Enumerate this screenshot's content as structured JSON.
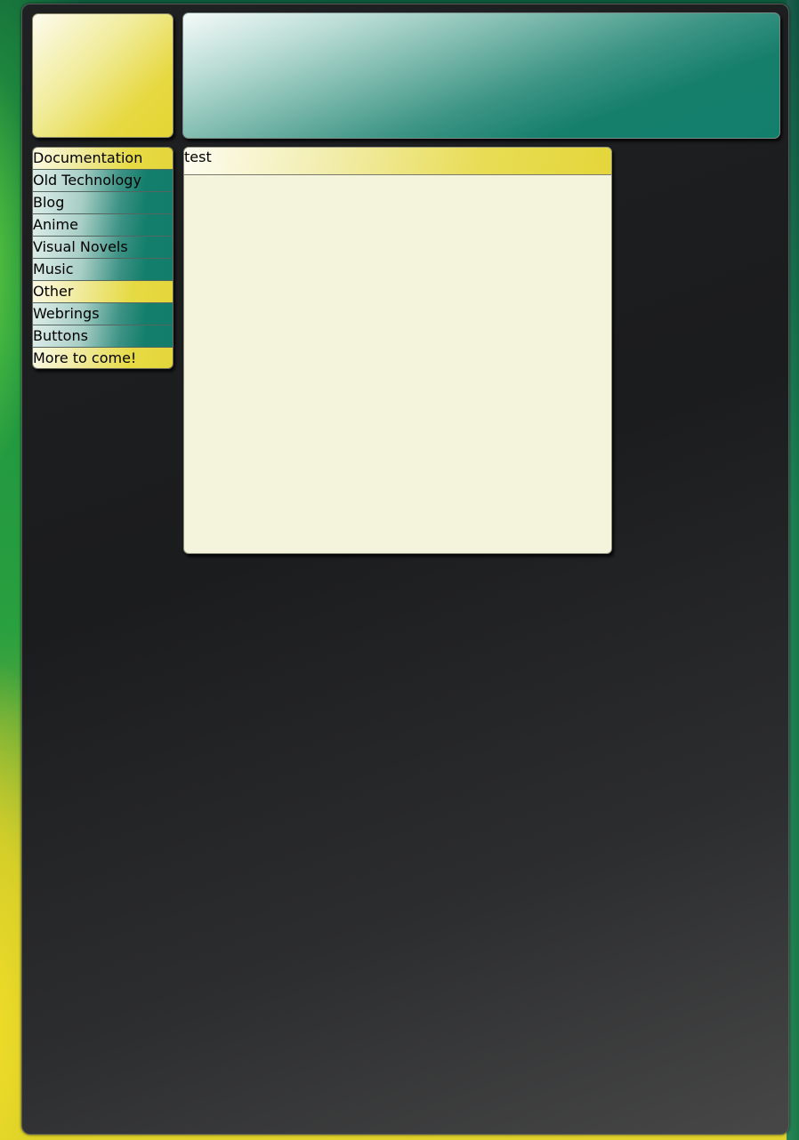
{
  "navigation": {
    "items": [
      {
        "label": "Documentation",
        "style": "yellow"
      },
      {
        "label": "Old Technology",
        "style": "teal"
      },
      {
        "label": "Blog",
        "style": "teal"
      },
      {
        "label": "Anime",
        "style": "teal"
      },
      {
        "label": "Visual Novels",
        "style": "teal"
      },
      {
        "label": "Music",
        "style": "teal"
      },
      {
        "label": "Other",
        "style": "yellow"
      },
      {
        "label": "Webrings",
        "style": "teal"
      },
      {
        "label": "Buttons",
        "style": "teal"
      },
      {
        "label": "More to come!",
        "style": "yellow"
      }
    ]
  },
  "content": {
    "title": "test",
    "body": ""
  },
  "colors": {
    "yellow_accent": "#e4d63a",
    "teal_accent": "#137d6b",
    "panel_background": "#1b1c1e",
    "content_background": "#f4f4dc"
  }
}
